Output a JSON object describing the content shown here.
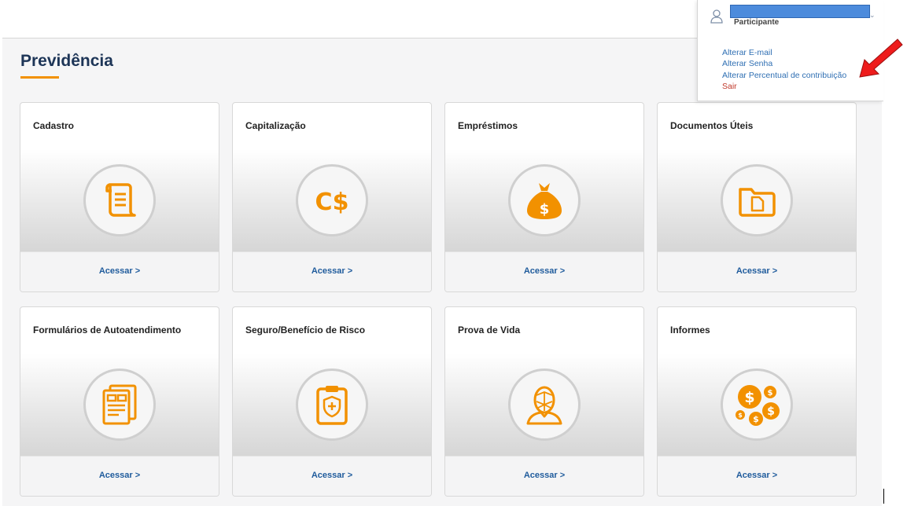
{
  "page": {
    "title": "Previdência"
  },
  "user_menu": {
    "role": "Participante",
    "links": [
      "Alterar E-mail",
      "Alterar Senha",
      "Alterar Percentual de contribuição"
    ],
    "logout": "Sair"
  },
  "cards": [
    {
      "title": "Cadastro",
      "icon": "scroll-document-icon",
      "action": "Acessar >"
    },
    {
      "title": "Capitalização",
      "icon": "currency-cs-icon",
      "action": "Acessar >"
    },
    {
      "title": "Empréstimos",
      "icon": "money-bag-icon",
      "action": "Acessar >"
    },
    {
      "title": "Documentos Úteis",
      "icon": "folder-document-icon",
      "action": "Acessar >"
    },
    {
      "title": "Formulários de Autoatendimento",
      "icon": "forms-icon",
      "action": "Acessar >"
    },
    {
      "title": "Seguro/Benefício de Risco",
      "icon": "clipboard-shield-icon",
      "action": "Acessar >"
    },
    {
      "title": "Prova de Vida",
      "icon": "face-recognition-icon",
      "action": "Acessar >"
    },
    {
      "title": "Informes",
      "icon": "coins-icon",
      "action": "Acessar >"
    }
  ],
  "colors": {
    "accent": "#f29100",
    "link": "#1f5b9c",
    "title": "#1d3557",
    "logout": "#c0392b"
  }
}
